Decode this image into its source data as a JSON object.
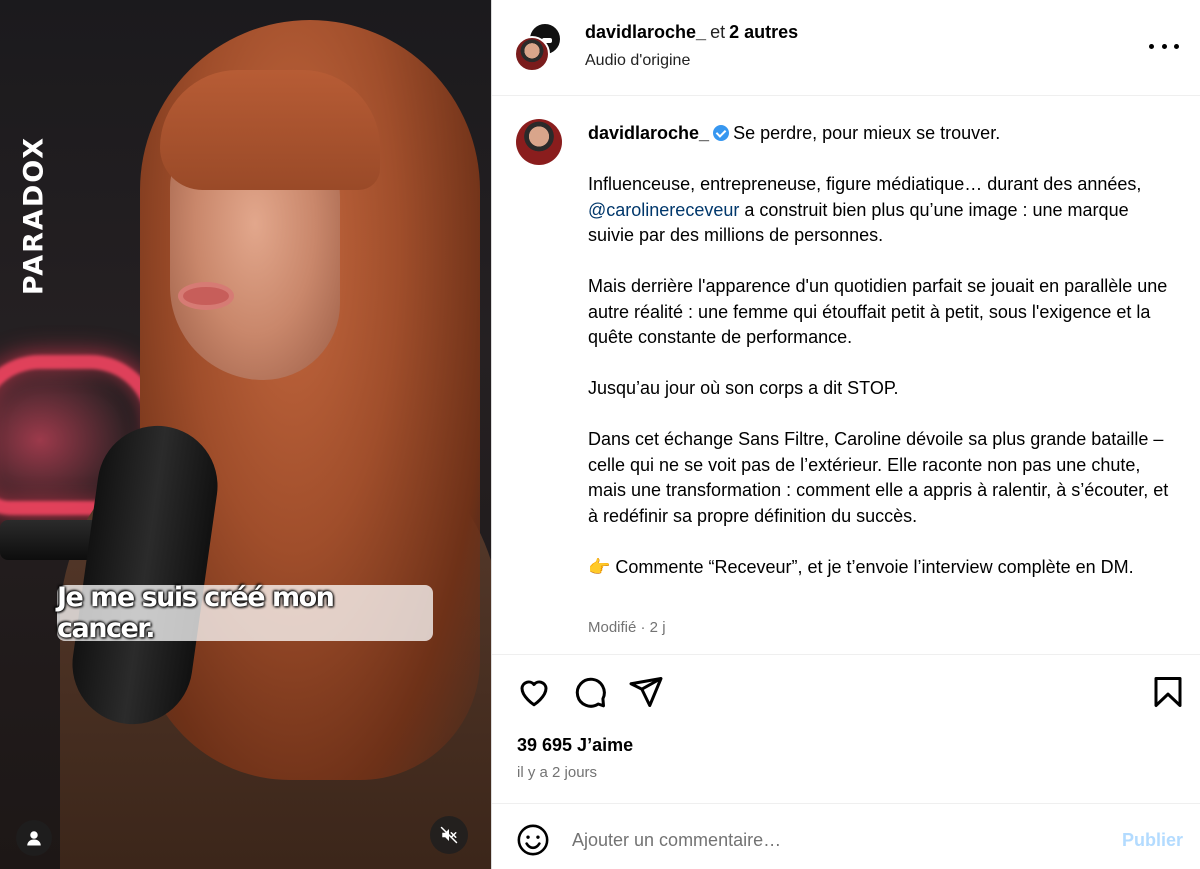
{
  "media": {
    "brand_watermark": "PARADOX",
    "subtitle": "Je me suis créé mon cancer."
  },
  "header": {
    "username": "davidlaroche_",
    "and_text": "et",
    "others": "2 autres",
    "audio": "Audio d'origine"
  },
  "caption": {
    "username": "davidlaroche_",
    "verified": true,
    "title": "Se perdre, pour mieux se trouver.",
    "p1_before": "Influenceuse, entrepreneuse, figure médiatique… durant des années, ",
    "p1_mention": "@carolinereceveur",
    "p1_after": " a construit bien plus qu’une image : une marque suivie par des millions de personnes.",
    "p2": "Mais derrière l'apparence d'un quotidien parfait se jouait en parallèle une autre réalité : une femme qui étouffait petit à petit, sous l'exigence et la quête constante de performance.",
    "p3": "Jusqu’au jour où son corps a dit STOP.",
    "p4": "Dans cet échange Sans Filtre, Caroline dévoile sa plus grande bataille – celle qui ne se voit pas de l’extérieur. Elle raconte non pas une chute, mais une transformation : comment elle a appris à ralentir, à s’écouter, et à redéfinir sa propre définition du succès.",
    "p5_emoji": "👉",
    "p5": " Commente “Receveur”, et je t’envoie l’interview complète en DM.",
    "meta": "Modifié · 2 j"
  },
  "stats": {
    "likes": "39 695 J’aime",
    "time": "il y a 2 jours"
  },
  "comment": {
    "placeholder": "Ajouter un commentaire…",
    "publish": "Publier"
  },
  "icons": [
    "heart-icon",
    "comment-icon",
    "share-icon",
    "bookmark-icon",
    "emoji-icon",
    "more-icon",
    "user-tag-icon",
    "muted-icon",
    "verified-badge-icon"
  ],
  "colors": {
    "verified": "#3797f0",
    "mention": "#00376b",
    "publish_disabled": "#b3dbff",
    "secondary_text": "#737373"
  }
}
